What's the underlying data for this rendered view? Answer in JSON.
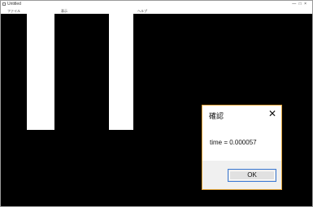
{
  "window": {
    "title": "Untitled",
    "controls": "— □ ×"
  },
  "menubar": {
    "items": [
      "ファイル",
      "表示",
      "ヘルプ"
    ]
  },
  "canvas": {
    "background": "#000000",
    "bar_color": "#ffffff"
  },
  "dialog": {
    "title": "確認",
    "message": "time = 0.000057",
    "ok_label": "OK",
    "accent_border": "#e2a53a"
  }
}
